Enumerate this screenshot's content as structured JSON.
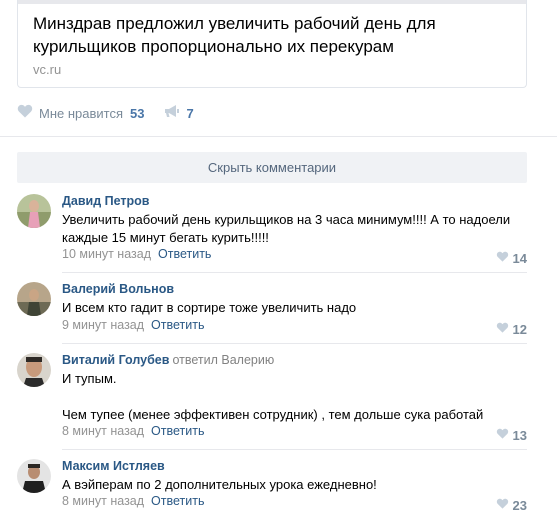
{
  "post": {
    "link_title": "Минздрав предложил увеличить рабочий день для курильщиков пропорционально их перекурам",
    "link_domain": "vc.ru"
  },
  "actions": {
    "like_label": "Мне нравится",
    "like_count": "53",
    "share_count": "7"
  },
  "comments_toggle": "Скрыть комментарии",
  "comments": [
    {
      "author": "Давид Петров",
      "reply_to_label": "",
      "reply_to_name": "",
      "text": "Увеличить рабочий день курильщиков на 3 часа минимум!!!! А то надоели каждые 15 минут бегать курить!!!!!",
      "time": "10 минут назад",
      "reply": "Ответить",
      "likes": "14"
    },
    {
      "author": "Валерий Вольнов",
      "reply_to_label": "",
      "reply_to_name": "",
      "text": "И всем кто гадит в сортире тоже увеличить надо",
      "time": "9 минут назад",
      "reply": "Ответить",
      "likes": "12"
    },
    {
      "author": "Виталий Голубев",
      "reply_to_label": "ответил",
      "reply_to_name": "Валерию",
      "text": "И тупым.\n\nЧем тупее (менее эффективен сотрудник) , тем дольше сука работай",
      "time": "8 минут назад",
      "reply": "Ответить",
      "likes": "13"
    },
    {
      "author": "Максим Истляев",
      "reply_to_label": "",
      "reply_to_name": "",
      "text": "А вэйперам по 2 дополнительных урока ежедневно!",
      "time": "8 минут назад",
      "reply": "Ответить",
      "likes": "23"
    }
  ],
  "colors": {
    "link_blue": "#2a5885",
    "accent": "#4a76a8",
    "muted": "#939393",
    "like_icon": "#c5d0db"
  },
  "icons": {
    "like": "heart-icon",
    "share": "megaphone-icon"
  }
}
